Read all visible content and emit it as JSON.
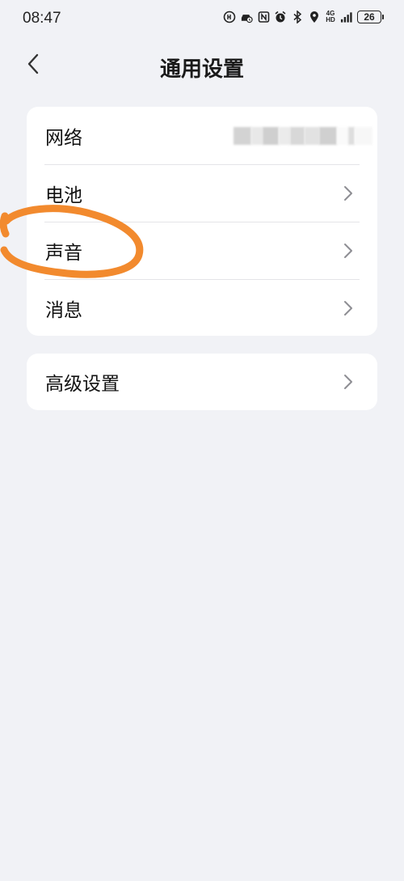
{
  "status_bar": {
    "time": "08:47",
    "network_label_top": "4G",
    "network_label_bottom": "HD",
    "battery": "26",
    "icons": [
      "hd-voice-icon",
      "car-connect-icon",
      "nfc-icon",
      "alarm-icon",
      "bluetooth-icon",
      "location-icon",
      "signal-icon",
      "battery-icon"
    ]
  },
  "header": {
    "title": "通用设置",
    "back_icon": "chevron-left-icon"
  },
  "settings": {
    "group1": [
      {
        "label": "网络",
        "value": "(blurred)"
      },
      {
        "label": "电池"
      },
      {
        "label": "声音"
      },
      {
        "label": "消息"
      }
    ],
    "group2": [
      {
        "label": "高级设置"
      }
    ]
  },
  "colors": {
    "background": "#f1f2f6",
    "card": "#ffffff",
    "annotation": "#f28a2e",
    "chevron": "#8e8e93"
  }
}
